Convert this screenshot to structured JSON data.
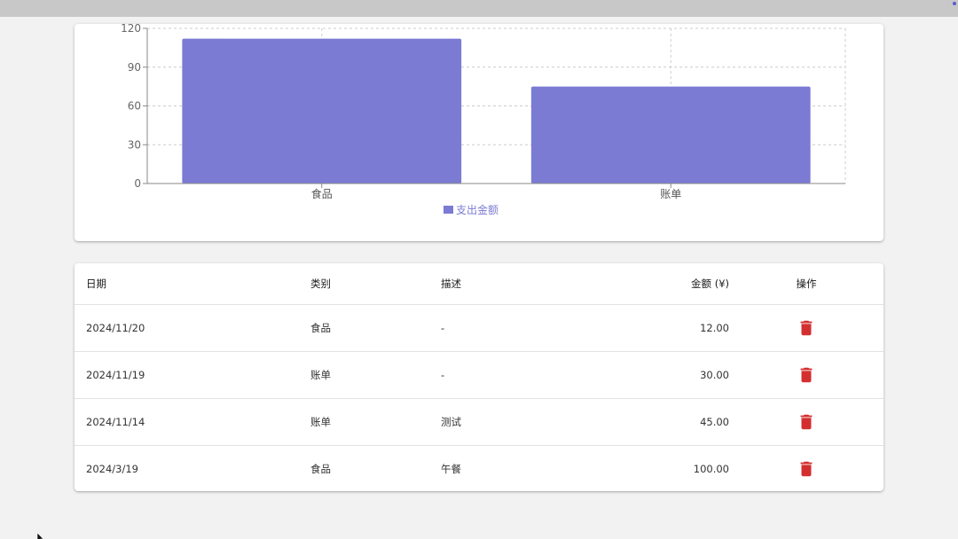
{
  "colors": {
    "bar": "#7b7bd4",
    "legend_text": "#7b7bd4",
    "delete_icon": "#d32f2f",
    "grid": "#cccccc",
    "axis": "#888888"
  },
  "chart_data": {
    "type": "bar",
    "categories": [
      "食品",
      "账单"
    ],
    "series": [
      {
        "name": "支出金额",
        "values": [
          112,
          75
        ]
      }
    ],
    "ylim": [
      0,
      120
    ],
    "yticks": [
      0,
      30,
      60,
      90,
      120
    ],
    "grid": true,
    "legend_position": "bottom-center"
  },
  "table": {
    "headers": {
      "date": "日期",
      "category": "类别",
      "description": "描述",
      "amount": "金额 (¥)",
      "action": "操作"
    },
    "rows": [
      {
        "date": "2024/11/20",
        "category": "食品",
        "description": "-",
        "amount": "12.00",
        "action_icon": "trash-icon"
      },
      {
        "date": "2024/11/19",
        "category": "账单",
        "description": "-",
        "amount": "30.00",
        "action_icon": "trash-icon"
      },
      {
        "date": "2024/11/14",
        "category": "账单",
        "description": "测试",
        "amount": "45.00",
        "action_icon": "trash-icon"
      },
      {
        "date": "2024/3/19",
        "category": "食品",
        "description": "午餐",
        "amount": "100.00",
        "action_icon": "trash-icon"
      }
    ]
  }
}
